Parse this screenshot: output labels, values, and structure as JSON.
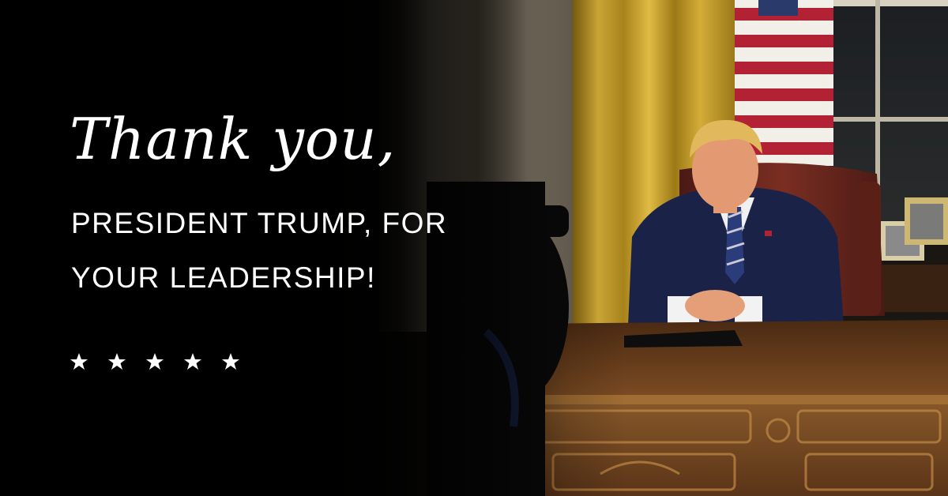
{
  "banner": {
    "headline": "Thank you,",
    "subline_1": "PRESIDENT TRUMP, FOR",
    "subline_2": "YOUR LEADERSHIP!",
    "stars": [
      "star",
      "star",
      "star",
      "star",
      "star"
    ]
  },
  "colors": {
    "background": "#000000",
    "text": "#ffffff",
    "curtain_gold": "#c9a227",
    "desk_wood": "#6b3f1e",
    "suit_navy": "#1a2347",
    "flag_red": "#b22234"
  }
}
